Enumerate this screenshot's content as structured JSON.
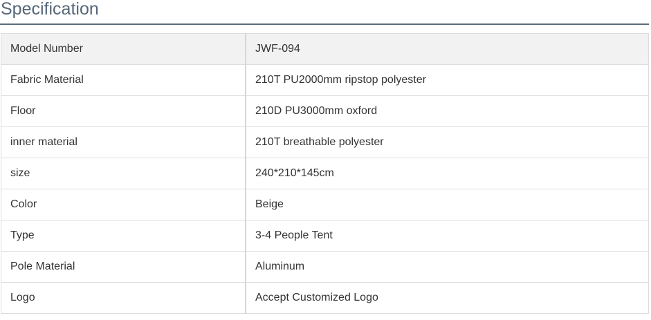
{
  "section": {
    "title": "Specification"
  },
  "spec_table": {
    "rows": [
      {
        "label": "Model Number",
        "value": "JWF-094"
      },
      {
        "label": "Fabric Material",
        "value": "210T PU2000mm ripstop polyester"
      },
      {
        "label": "Floor",
        "value": "210D PU3000mm oxford"
      },
      {
        "label": "inner material",
        "value": "210T breathable polyester"
      },
      {
        "label": "size",
        "value": "240*210*145cm"
      },
      {
        "label": "Color",
        "value": "Beige"
      },
      {
        "label": "Type",
        "value": "3-4 People Tent"
      },
      {
        "label": "Pole Material",
        "value": "Aluminum"
      },
      {
        "label": "Logo",
        "value": "Accept Customized Logo"
      }
    ]
  },
  "colors": {
    "title": "#566779",
    "rule": "#5c6b78",
    "header_row_bg": "#f2f2f2",
    "border": "#dcdcdc",
    "text": "#333333"
  }
}
